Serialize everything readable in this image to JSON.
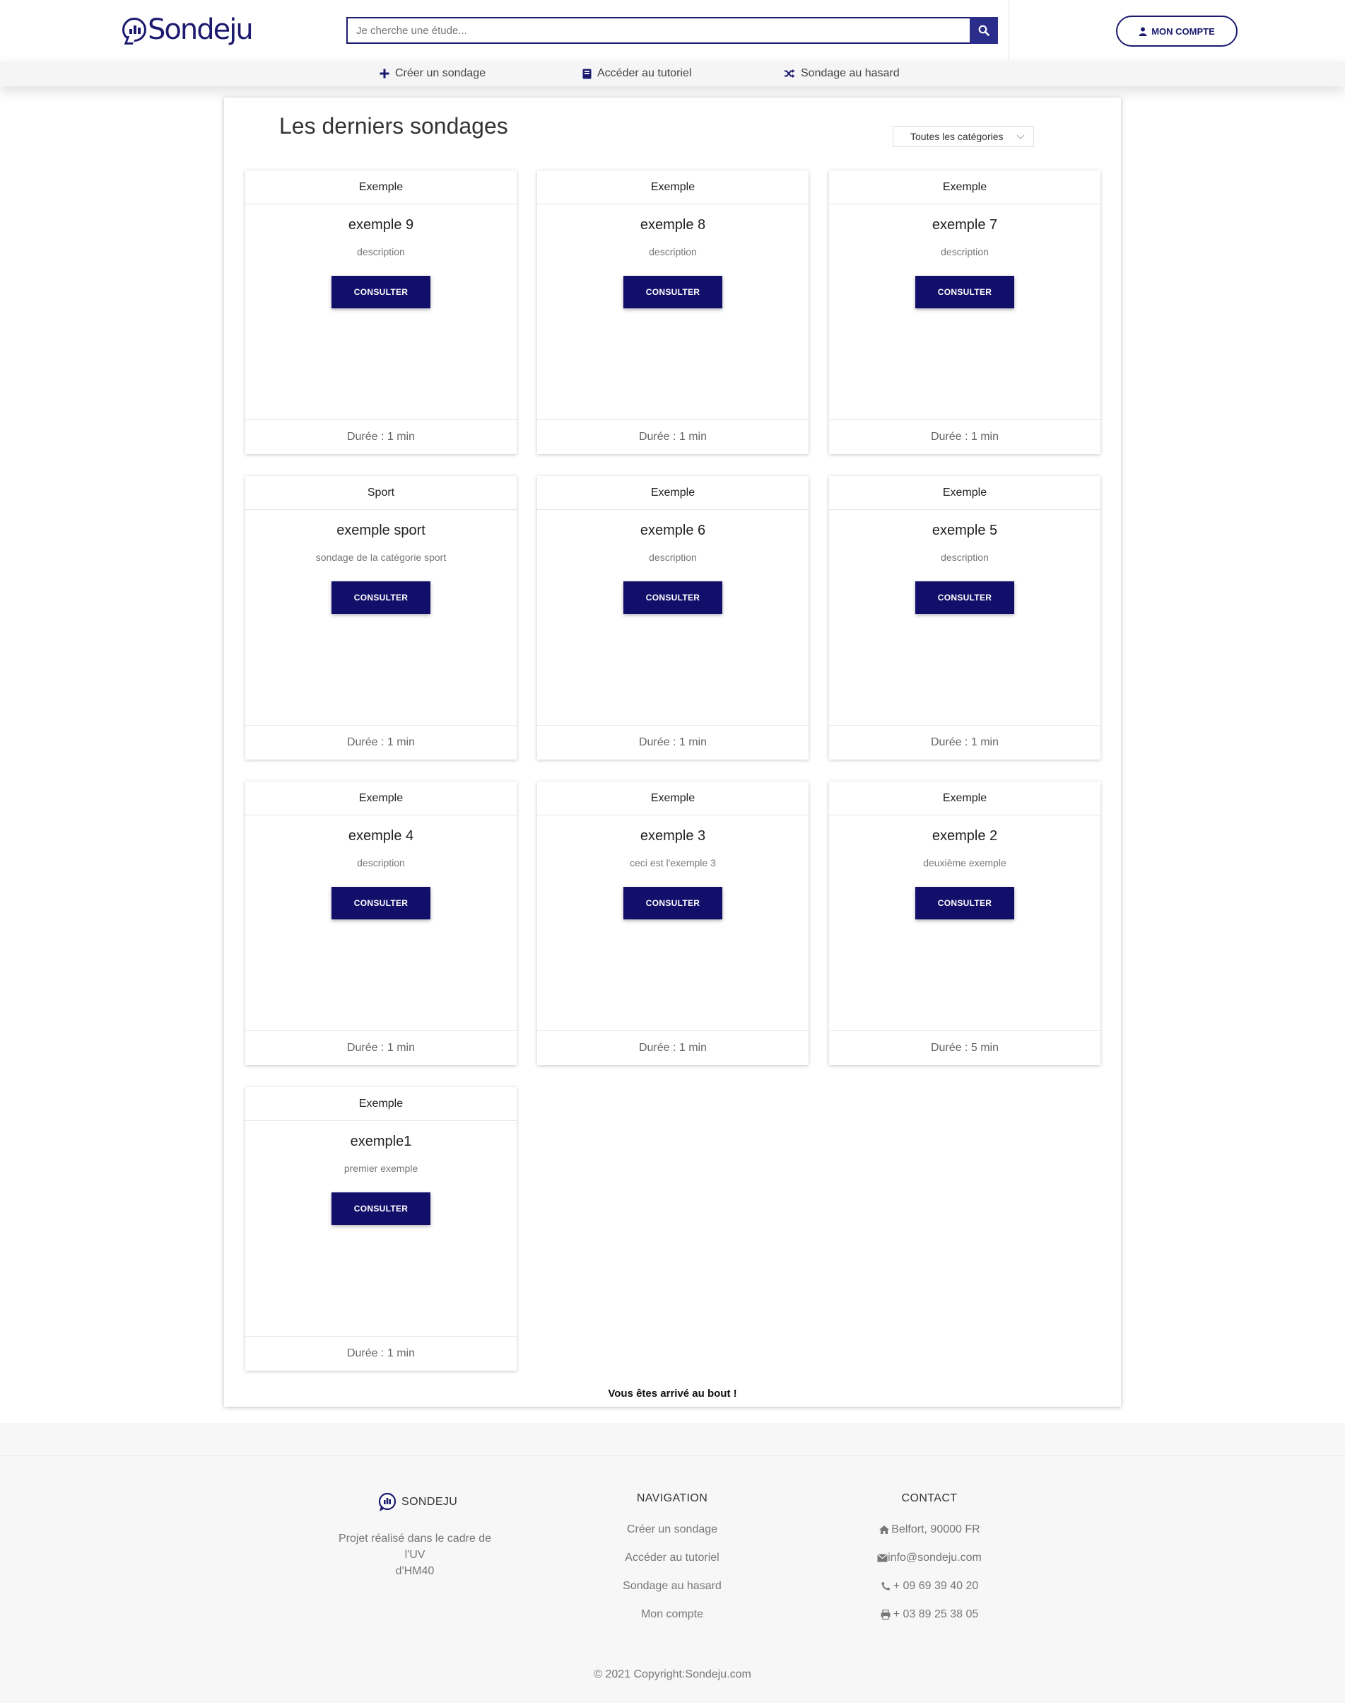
{
  "header": {
    "logo_text": "Sondeju",
    "search_placeholder": "Je cherche une étude...",
    "account_label": "MON COMPTE"
  },
  "nav": {
    "items": [
      {
        "label": "Créer un sondage",
        "icon": "plus-icon"
      },
      {
        "label": "Accéder au tutoriel",
        "icon": "book-icon"
      },
      {
        "label": "Sondage au hasard",
        "icon": "shuffle-icon"
      }
    ]
  },
  "main": {
    "title": "Les derniers sondages",
    "category_select": "Toutes les catégories",
    "end_text": "Vous êtes arrivé au bout !"
  },
  "cards": [
    {
      "category": "Exemple",
      "title": "exemple 9",
      "description": "description",
      "button": "CONSULTER",
      "duration": "Durée : 1 min"
    },
    {
      "category": "Exemple",
      "title": "exemple 8",
      "description": "description",
      "button": "CONSULTER",
      "duration": "Durée : 1 min"
    },
    {
      "category": "Exemple",
      "title": "exemple 7",
      "description": "description",
      "button": "CONSULTER",
      "duration": "Durée : 1 min"
    },
    {
      "category": "Sport",
      "title": "exemple sport",
      "description": "sondage de la catégorie sport",
      "button": "CONSULTER",
      "duration": "Durée : 1 min"
    },
    {
      "category": "Exemple",
      "title": "exemple 6",
      "description": "description",
      "button": "CONSULTER",
      "duration": "Durée : 1 min"
    },
    {
      "category": "Exemple",
      "title": "exemple 5",
      "description": "description",
      "button": "CONSULTER",
      "duration": "Durée : 1 min"
    },
    {
      "category": "Exemple",
      "title": "exemple 4",
      "description": "description",
      "button": "CONSULTER",
      "duration": "Durée : 1 min"
    },
    {
      "category": "Exemple",
      "title": "exemple 3",
      "description": "ceci est l'exemple 3",
      "button": "CONSULTER",
      "duration": "Durée : 1 min"
    },
    {
      "category": "Exemple",
      "title": "exemple 2",
      "description": "deuxième exemple",
      "button": "CONSULTER",
      "duration": "Durée : 5 min"
    },
    {
      "category": "Exemple",
      "title": "exemple1",
      "description": "premier exemple",
      "button": "CONSULTER",
      "duration": "Durée : 1 min"
    }
  ],
  "footer": {
    "brand": "SONDEJU",
    "brand_desc_line1": "Projet réalisé dans le cadre de l'UV",
    "brand_desc_line2": "d'HM40",
    "nav_heading": "NAVIGATION",
    "nav_links": [
      "Créer un sondage",
      "Accéder au tutoriel",
      "Sondage au hasard",
      "Mon compte"
    ],
    "contact_heading": "CONTACT",
    "contacts": [
      {
        "icon": "home-icon",
        "text": "Belfort, 90000 FR"
      },
      {
        "icon": "envelope-icon",
        "text": "info@sondeju.com"
      },
      {
        "icon": "phone-icon",
        "text": "+ 09 69 39 40 20"
      },
      {
        "icon": "printer-icon",
        "text": "+ 03 89 25 38 05"
      }
    ],
    "copyright": "© 2021 Copyright:Sondeju.com"
  },
  "colors": {
    "brand": "#1c1a6e",
    "button": "#120f6b",
    "search_button": "#2b2d8a"
  }
}
